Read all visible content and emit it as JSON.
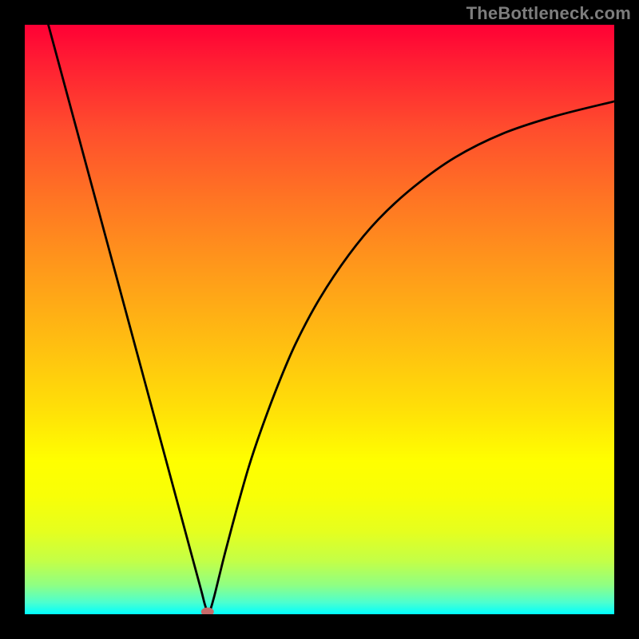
{
  "watermark": "TheBottleneck.com",
  "colors": {
    "frame": "#000000",
    "curve": "#000000",
    "marker": "#c76a6a",
    "gradient_top": "#ff0035",
    "gradient_bottom": "#00ffff"
  },
  "chart_data": {
    "type": "line",
    "title": "",
    "xlabel": "",
    "ylabel": "",
    "xlim": [
      0,
      100
    ],
    "ylim": [
      0,
      100
    ],
    "series": [
      {
        "name": "bottleneck-curve",
        "x": [
          4,
          6,
          8,
          10,
          12,
          14,
          16,
          18,
          20,
          22,
          24,
          26,
          28,
          29,
          30,
          30.6,
          31.2,
          32,
          33,
          34,
          36,
          38,
          40,
          43,
          46,
          50,
          55,
          60,
          66,
          73,
          81,
          90,
          100
        ],
        "y": [
          100,
          92.6,
          85.2,
          77.8,
          70.4,
          63,
          55.6,
          48.2,
          40.8,
          33.4,
          26,
          18.6,
          11.2,
          7.5,
          3.8,
          1.5,
          0.2,
          2.5,
          6.5,
          10.5,
          18,
          25,
          31,
          39,
          46,
          53.5,
          61,
          67,
          72.5,
          77.5,
          81.5,
          84.5,
          87
        ]
      }
    ],
    "marker": {
      "x": 31,
      "y": 0.4
    },
    "grid": false,
    "legend": false
  }
}
